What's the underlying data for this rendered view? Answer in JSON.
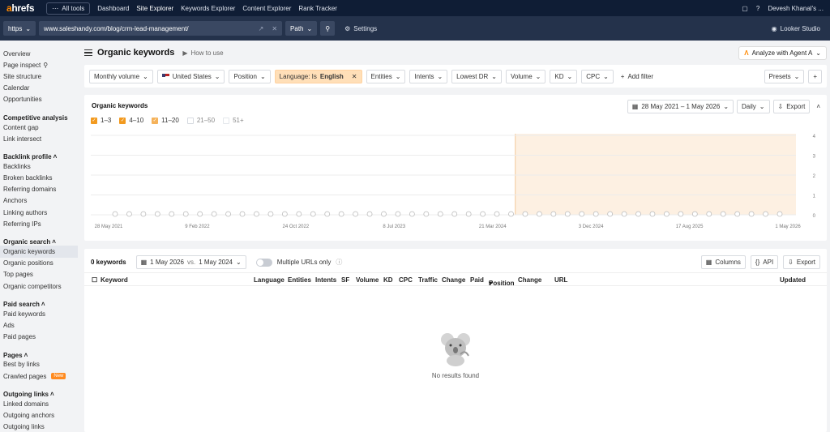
{
  "topbar": {
    "logo_accent": "a",
    "logo_rest": "hrefs",
    "all_tools": "All tools",
    "nav": [
      "Dashboard",
      "Site Explorer",
      "Keywords Explorer",
      "Content Explorer",
      "Rank Tracker"
    ],
    "user": "Devesh Khanal's ..."
  },
  "urlbar": {
    "protocol": "https",
    "url": "www.saleshandy.com/blog/crm-lead-management/",
    "mode": "Path",
    "settings": "Settings",
    "looker": "Looker Studio"
  },
  "sidebar": {
    "top": [
      "Overview",
      "Page inspect",
      "Site structure",
      "Calendar",
      "Opportunities"
    ],
    "sections": [
      {
        "title": "Competitive analysis",
        "items": [
          "Content gap",
          "Link intersect"
        ]
      },
      {
        "title": "Backlink profile",
        "items": [
          "Backlinks",
          "Broken backlinks",
          "Referring domains",
          "Anchors",
          "Linking authors",
          "Referring IPs"
        ]
      },
      {
        "title": "Organic search",
        "items": [
          "Organic keywords",
          "Organic positions",
          "Top pages",
          "Organic competitors"
        ]
      },
      {
        "title": "Paid search",
        "items": [
          "Paid keywords",
          "Ads",
          "Paid pages"
        ]
      },
      {
        "title": "Pages",
        "items": [
          "Best by links",
          "Crawled pages"
        ]
      },
      {
        "title": "Outgoing links",
        "items": [
          "Linked domains",
          "Outgoing anchors",
          "Outgoing links"
        ]
      }
    ],
    "new_badge": "New"
  },
  "header": {
    "title": "Organic keywords",
    "how_to": "How to use",
    "agent": "Analyze with Agent A"
  },
  "filters": {
    "monthly_volume": "Monthly volume",
    "country": "United States",
    "position": "Position",
    "language_prefix": "Language: Is ",
    "language_value": "English",
    "entities": "Entities",
    "intents": "Intents",
    "lowest_dr": "Lowest DR",
    "volume": "Volume",
    "kd": "KD",
    "cpc": "CPC",
    "add_filter": "Add filter",
    "presets": "Presets"
  },
  "chart_panel": {
    "title": "Organic keywords",
    "date_range": "28 May 2021 – 1 May 2026",
    "interval": "Daily",
    "export": "Export",
    "legend": [
      {
        "label": "1–3",
        "color": "#f29a1f",
        "checked": true
      },
      {
        "label": "4–10",
        "color": "#f29a1f",
        "checked": true
      },
      {
        "label": "11–20",
        "color": "#f5b25a",
        "checked": true
      },
      {
        "label": "21–50",
        "color": "#d5d9df",
        "checked": false
      },
      {
        "label": "51+",
        "color": "#e4e7eb",
        "checked": false
      }
    ]
  },
  "chart_data": {
    "type": "line",
    "title": "Organic keywords",
    "x_ticks": [
      "28 May 2021",
      "9 Feb 2022",
      "24 Oct 2022",
      "8 Jul 2023",
      "21 Mar 2024",
      "3 Dec 2024",
      "17 Aug 2025",
      "1 May 2026"
    ],
    "y_ticks": [
      0,
      1,
      2,
      3,
      4
    ],
    "ylim": [
      0,
      4
    ],
    "series": [],
    "annotation_markers": 48,
    "shaded_range": [
      "21 Mar 2024",
      "1 May 2026"
    ],
    "grid": true
  },
  "table_panel": {
    "count": "0 keywords",
    "date_a": "1 May 2026",
    "vs": "vs.",
    "date_b": "1 May 2024",
    "multiple_urls": "Multiple URLs only",
    "columns_btn": "Columns",
    "api_btn": "API",
    "export_btn": "Export",
    "columns": [
      "Keyword",
      "Language",
      "Entities",
      "Intents",
      "SF",
      "Volume",
      "KD",
      "CPC",
      "Traffic",
      "Change",
      "Paid",
      "Position",
      "Change",
      "URL",
      "Updated"
    ],
    "empty": "No results found"
  },
  "colors": {
    "topbar": "#0f1d35",
    "urlbar": "#24324b",
    "accent": "#ff8800",
    "shade": "#fdf0e2"
  }
}
